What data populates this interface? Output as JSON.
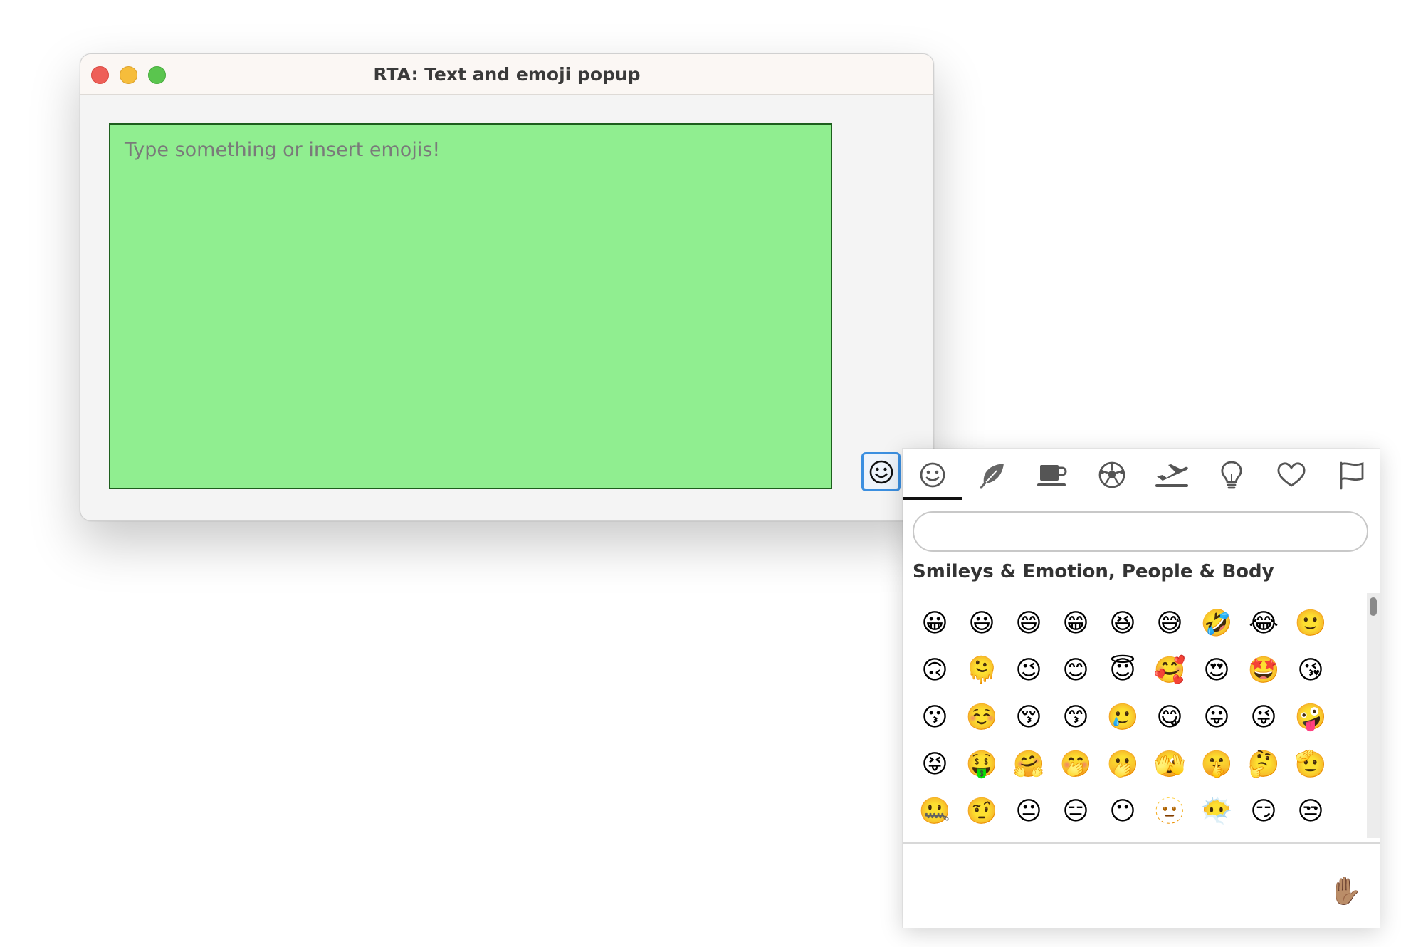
{
  "window": {
    "title": "RTA: Text and emoji popup",
    "textarea_placeholder": "Type something or insert emojis!",
    "emoji_button_icon": "smiley-face-icon"
  },
  "popup": {
    "tabs": [
      {
        "icon": "smiley-icon",
        "active": true
      },
      {
        "icon": "leaf-icon",
        "active": false
      },
      {
        "icon": "coffee-cup-icon",
        "active": false
      },
      {
        "icon": "soccer-ball-icon",
        "active": false
      },
      {
        "icon": "airplane-icon",
        "active": false
      },
      {
        "icon": "lightbulb-icon",
        "active": false
      },
      {
        "icon": "heart-icon",
        "active": false
      },
      {
        "icon": "flag-icon",
        "active": false
      }
    ],
    "search_value": "",
    "section_title": "Smileys & Emotion, People & Body",
    "emojis": [
      "😀",
      "😃",
      "😄",
      "😁",
      "😆",
      "😅",
      "🤣",
      "😂",
      "🙂",
      "🙃",
      "🫠",
      "😉",
      "😊",
      "😇",
      "🥰",
      "😍",
      "🤩",
      "😘",
      "😗",
      "☺️",
      "😚",
      "😙",
      "🥲",
      "😋",
      "😛",
      "😜",
      "🤪",
      "😝",
      "🤑",
      "🤗",
      "🤭",
      "🫢",
      "🫣",
      "🤫",
      "🤔",
      "🫡",
      "🤐",
      "🤨",
      "😐",
      "😑",
      "😶",
      "🫥",
      "😶‍🌫️",
      "😏",
      "😒"
    ],
    "skin_tone": "✋🏽"
  },
  "colors": {
    "textarea_bg": "#90ee90",
    "accent_blue": "#3b8fe0"
  }
}
